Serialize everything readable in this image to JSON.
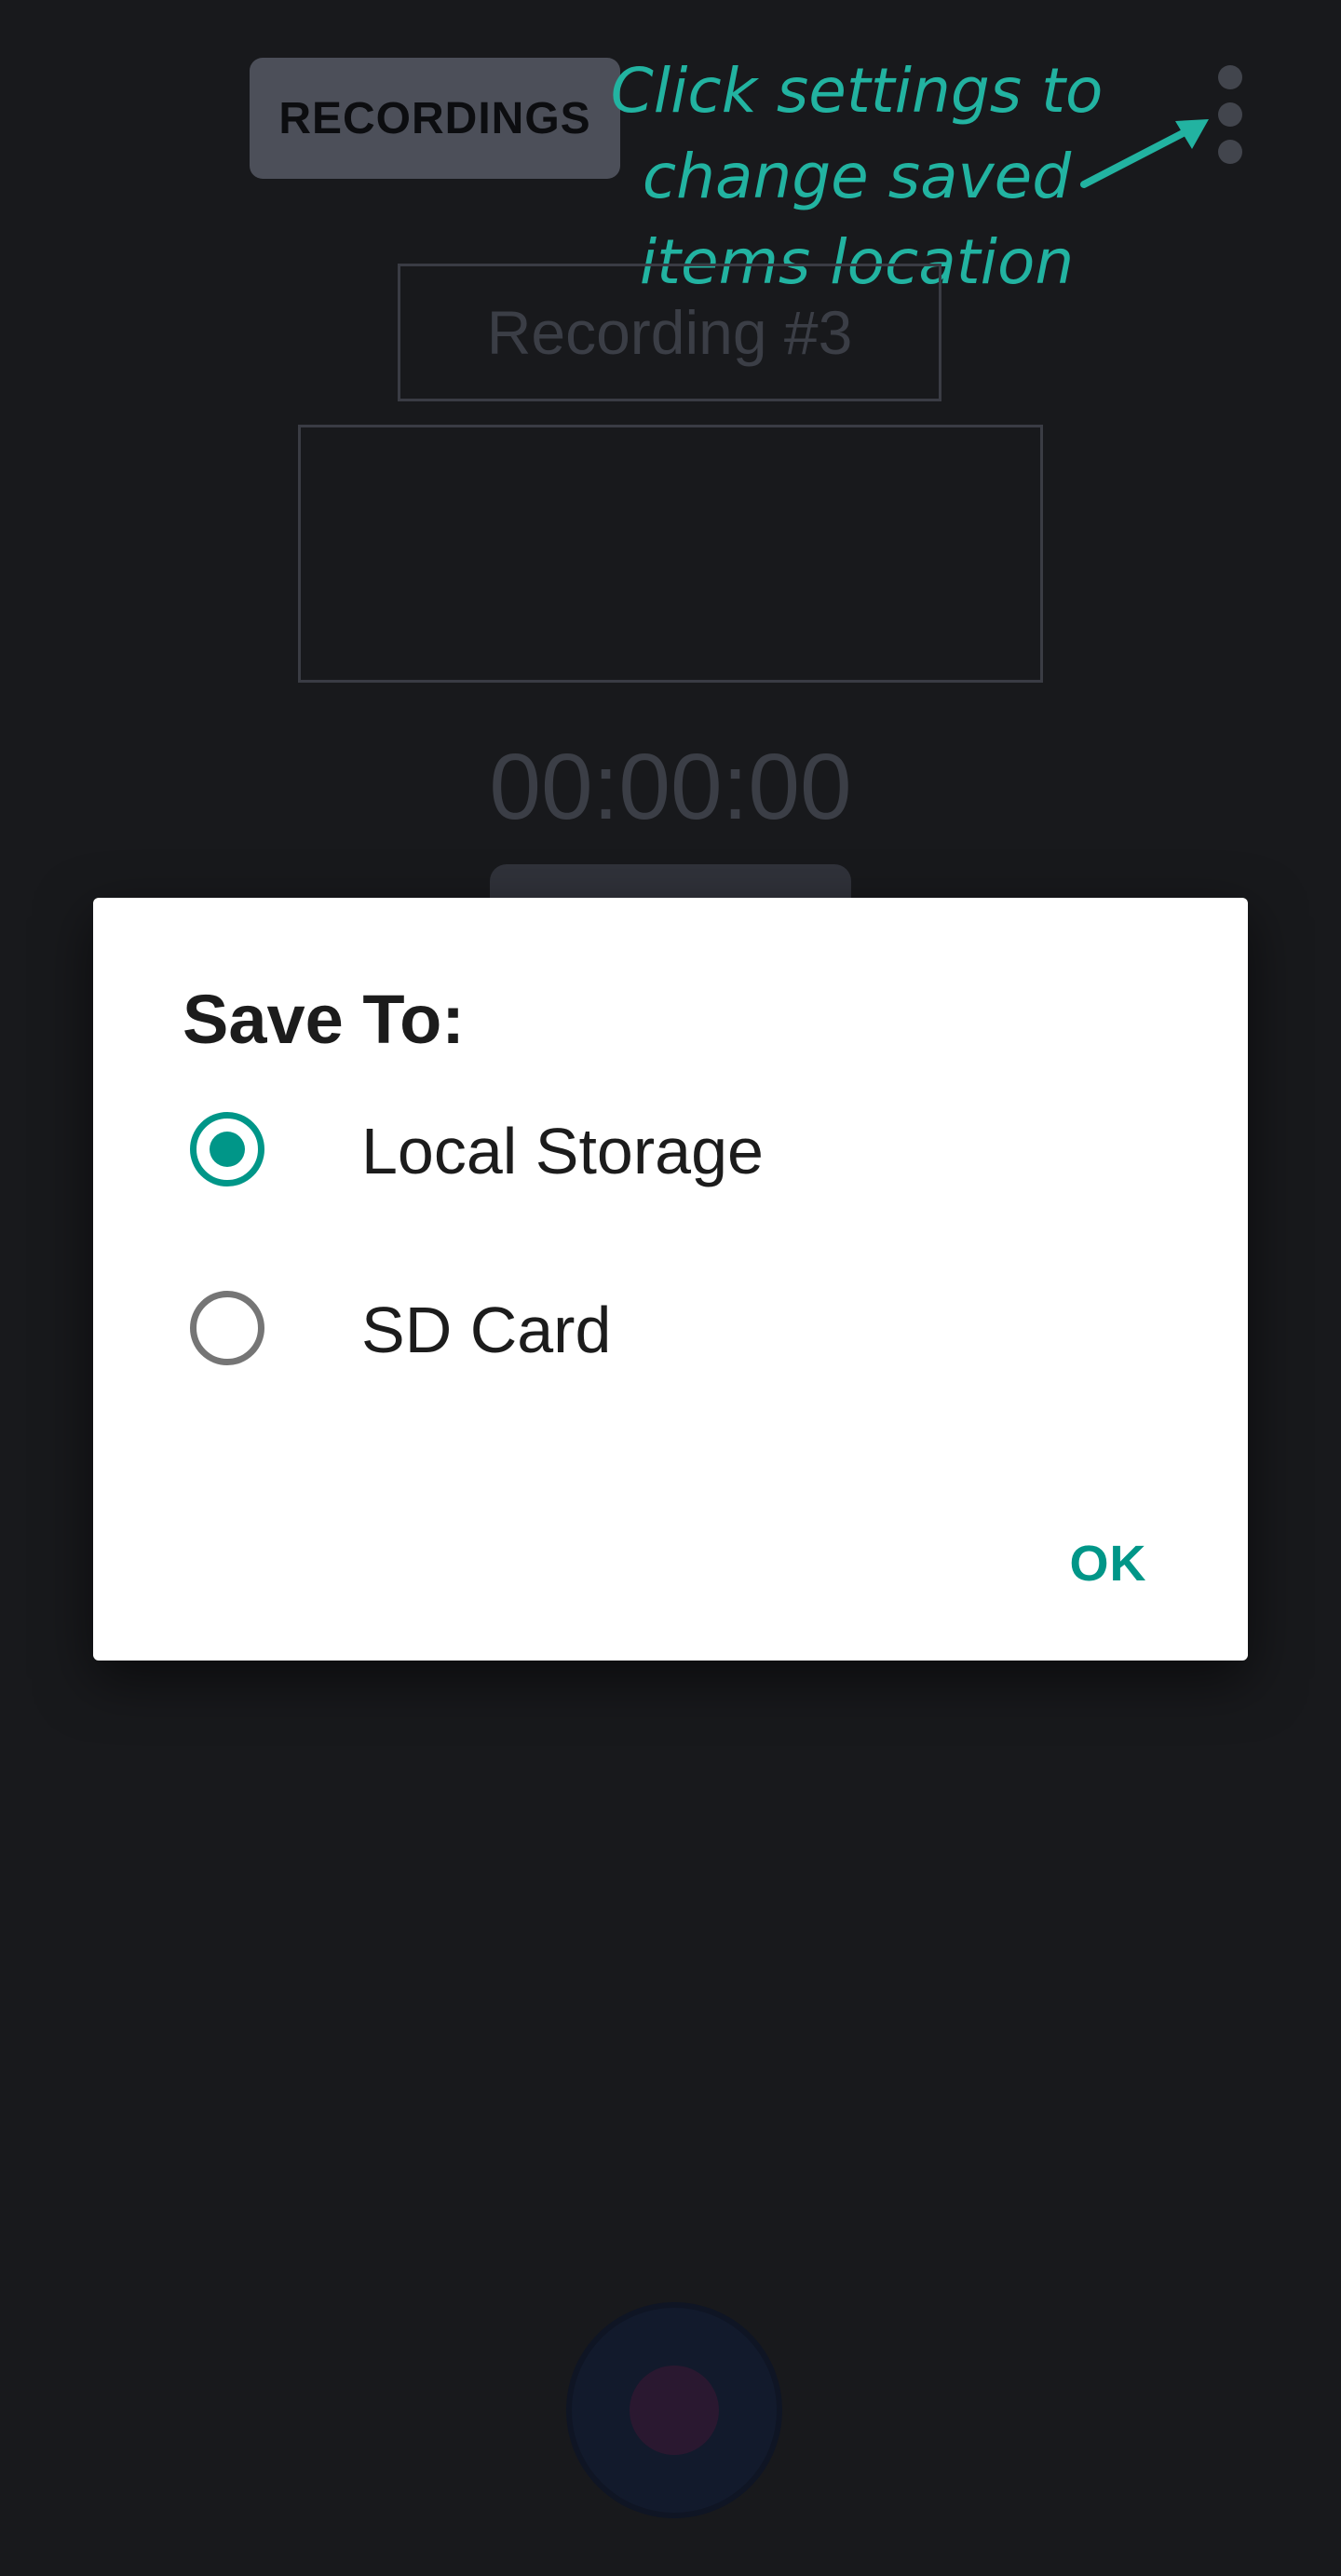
{
  "app": {
    "recordings_label": "RECORDINGS",
    "recording_title_placeholder": "Recording #3",
    "timer": "00:00:00",
    "overflow_menu_icon": "more-vert-icon",
    "record_icon": "record-icon"
  },
  "annotation": {
    "text_line1": "Click settings to",
    "text_line2": "change saved",
    "text_line3": "items location",
    "color": "#22b3a1"
  },
  "dialog": {
    "title": "Save To:",
    "options": [
      {
        "label": "Local Storage",
        "selected": true
      },
      {
        "label": "SD Card",
        "selected": false
      }
    ],
    "ok_label": "OK",
    "accent_color": "#009688"
  }
}
